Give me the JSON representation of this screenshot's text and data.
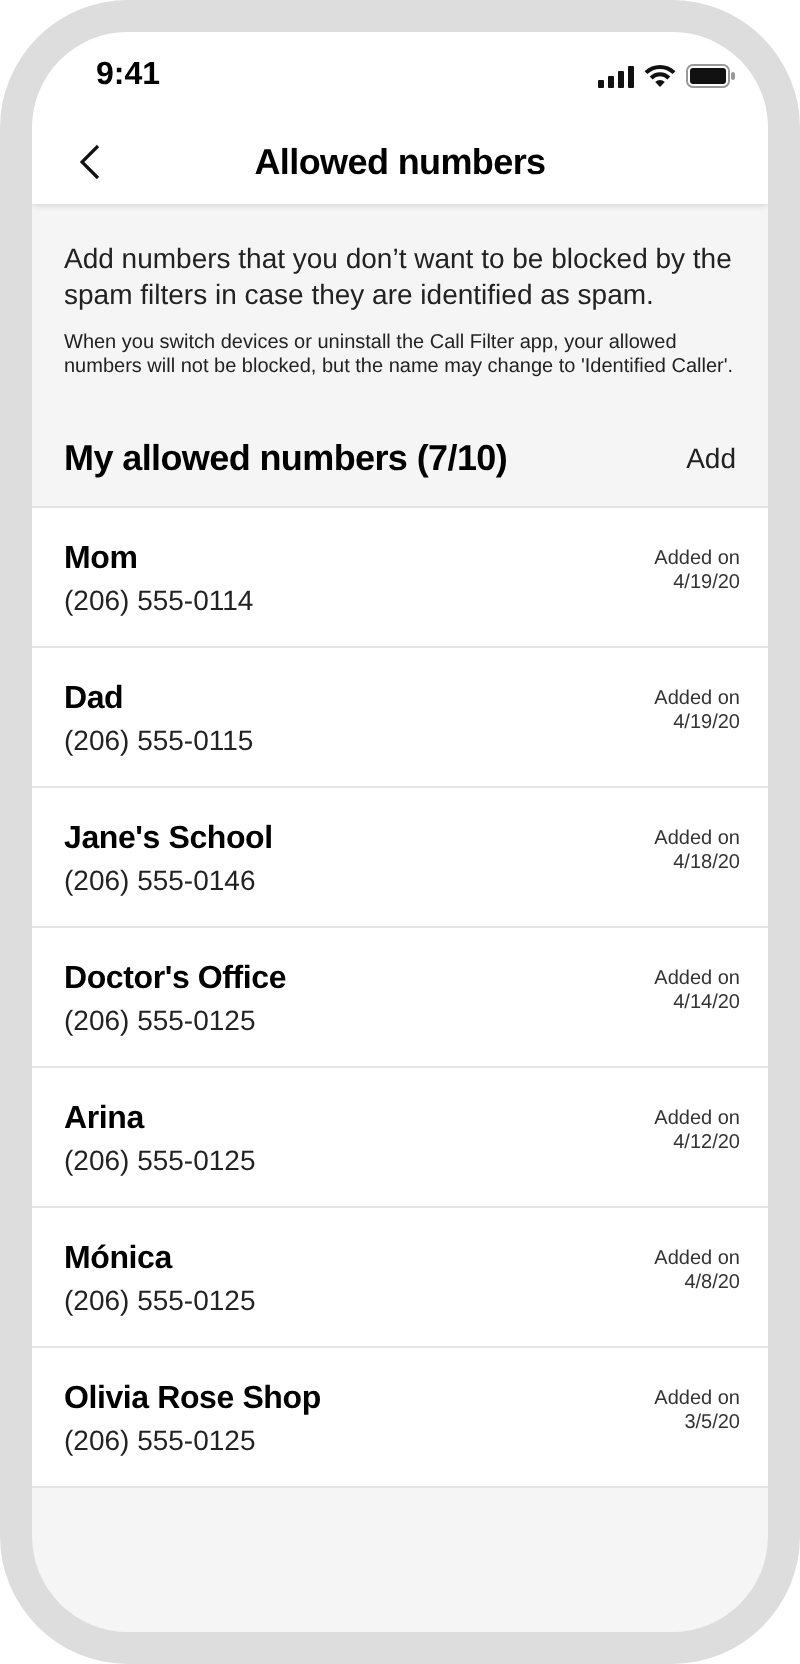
{
  "status_bar": {
    "time": "9:41"
  },
  "header": {
    "title": "Allowed numbers"
  },
  "intro": "Add numbers that you don’t want to be blocked by the spam filters in case they are identified as spam.",
  "note": "When you switch devices or uninstall the Call Filter app, your allowed numbers will not be blocked, but the name may change to 'Identified Caller'.",
  "section": {
    "title": "My allowed numbers (7/10)",
    "action": "Add"
  },
  "contacts": [
    {
      "name": "Mom",
      "number": "(206) 555-0114",
      "added_label": "Added on",
      "date": "4/19/20"
    },
    {
      "name": "Dad",
      "number": "(206) 555-0115",
      "added_label": "Added on",
      "date": "4/19/20"
    },
    {
      "name": "Jane's School",
      "number": "(206) 555-0146",
      "added_label": "Added on",
      "date": "4/18/20"
    },
    {
      "name": "Doctor's Office",
      "number": "(206) 555-0125",
      "added_label": "Added on",
      "date": "4/14/20"
    },
    {
      "name": "Arina",
      "number": "(206) 555-0125",
      "added_label": "Added on",
      "date": "4/12/20"
    },
    {
      "name": "Mónica",
      "number": "(206) 555-0125",
      "added_label": "Added on",
      "date": "4/8/20"
    },
    {
      "name": "Olivia Rose Shop",
      "number": "(206) 555-0125",
      "added_label": "Added on",
      "date": "3/5/20"
    }
  ]
}
